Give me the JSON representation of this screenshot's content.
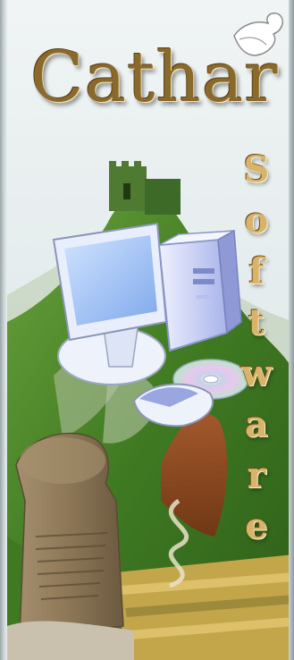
{
  "brand": {
    "word1": "Cathar",
    "word2_letters": [
      "S",
      "o",
      "f",
      "t",
      "w",
      "a",
      "r",
      "e"
    ]
  },
  "icons": [
    "dove-icon",
    "castle-tower",
    "computer-monitor-icon",
    "computer-tower-icon",
    "compact-disc-icon",
    "mouse-icon",
    "standing-stone"
  ],
  "colors": {
    "title_gold": "#8a6a2c",
    "letter_gold": "#d8b46a",
    "sky": "#e6eef0",
    "hill_green": "#4f8a2c",
    "monitor_blue": "#a9c8f2"
  }
}
